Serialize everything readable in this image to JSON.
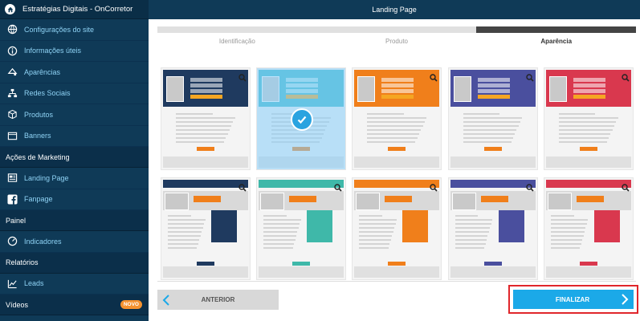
{
  "app": {
    "title": "Estratégias Digitais - OnCorretor"
  },
  "header": {
    "title": "Landing Page"
  },
  "sidebar": {
    "items": [
      {
        "label": "Configurações do site",
        "icon": "globe-icon"
      },
      {
        "label": "Informações úteis",
        "icon": "info-icon"
      },
      {
        "label": "Aparências",
        "icon": "palette-icon"
      },
      {
        "label": "Redes Sociais",
        "icon": "network-icon"
      },
      {
        "label": "Produtos",
        "icon": "box-icon"
      },
      {
        "label": "Banners",
        "icon": "banner-icon"
      }
    ],
    "sections": {
      "marketing": "Ações de Marketing",
      "painel": "Painel",
      "relatorios": "Relatórios",
      "videos": "Vídeos",
      "videos_badge": "NOVO"
    },
    "marketing_items": [
      {
        "label": "Landing Page",
        "icon": "landing-page-icon"
      },
      {
        "label": "Fanpage",
        "icon": "facebook-icon"
      }
    ],
    "painel_items": [
      {
        "label": "Indicadores",
        "icon": "gauge-icon"
      }
    ],
    "relatorios_items": [
      {
        "label": "Leads",
        "icon": "chart-icon"
      }
    ]
  },
  "wizard": {
    "steps": [
      "Identificação",
      "Produto",
      "Aparência"
    ],
    "active_step": "Aparência",
    "progress_fraction": 1.0
  },
  "templates": {
    "row1_colors": [
      "#1f3a5f",
      "#3fb8c9",
      "#f07f1b",
      "#4a4f9e",
      "#d9384e"
    ],
    "row2_colors": [
      "#1f3a5f",
      "#3fb8a9",
      "#f07f1b",
      "#4a4f9e",
      "#d9384e"
    ],
    "selected_index": 1
  },
  "buttons": {
    "prev_label": "ANTERIOR",
    "finish_label": "FINALIZAR"
  },
  "colors": {
    "accent": "#1ba9e8",
    "sidebar": "#0f3a57",
    "highlight": "#e0262b"
  }
}
